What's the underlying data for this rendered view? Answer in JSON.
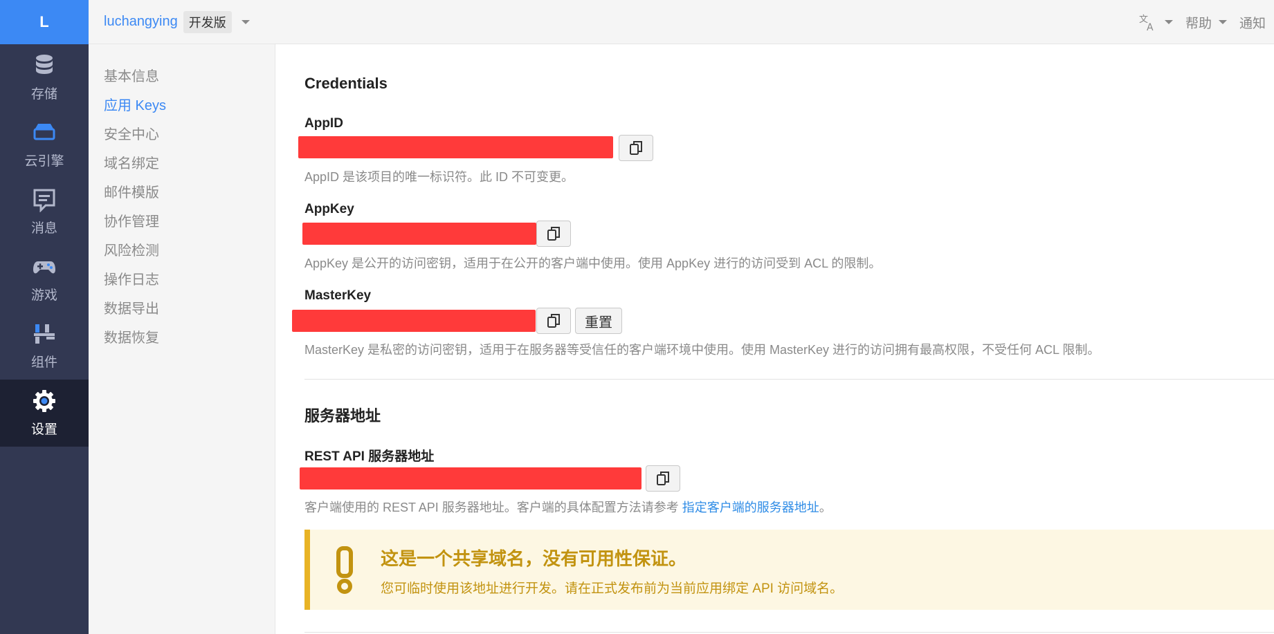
{
  "rail": {
    "logo": "L",
    "items": [
      {
        "label": "存储",
        "icon": "database-icon"
      },
      {
        "label": "云引擎",
        "icon": "server-icon"
      },
      {
        "label": "消息",
        "icon": "message-icon"
      },
      {
        "label": "游戏",
        "icon": "gamepad-icon"
      },
      {
        "label": "组件",
        "icon": "components-icon"
      },
      {
        "label": "设置",
        "icon": "gear-icon",
        "active": true
      }
    ]
  },
  "topbar": {
    "app_name": "luchangying",
    "app_badge": "开发版",
    "help": "帮助",
    "notify": "通知"
  },
  "subnav": {
    "items": [
      "基本信息",
      "应用 Keys",
      "安全中心",
      "域名绑定",
      "邮件模版",
      "协作管理",
      "风险检测",
      "操作日志",
      "数据导出",
      "数据恢复"
    ],
    "active_index": 1
  },
  "credentials": {
    "title": "Credentials",
    "appid": {
      "label": "AppID",
      "help": "AppID 是该项目的唯一标识符。此 ID 不可变更。"
    },
    "appkey": {
      "label": "AppKey",
      "help": "AppKey 是公开的访问密钥，适用于在公开的客户端中使用。使用 AppKey 进行的访问受到 ACL 的限制。"
    },
    "masterkey": {
      "label": "MasterKey",
      "reset_label": "重置",
      "help": "MasterKey 是私密的访问密钥，适用于在服务器等受信任的客户端环境中使用。使用 MasterKey 进行的访问拥有最高权限，不受任何 ACL 限制。"
    }
  },
  "server": {
    "title": "服务器地址",
    "rest_label": "REST API 服务器地址",
    "rest_help_prefix": "客户端使用的 REST API 服务器地址。客户端的具体配置方法请参考 ",
    "rest_help_link": "指定客户端的服务器地址",
    "rest_help_suffix": "。",
    "notice_title": "这是一个共享域名，没有可用性保证。",
    "notice_text": "您可临时使用该地址进行开发。请在正式发布前为当前应用绑定 API 访问域名。"
  },
  "colors": {
    "accent": "#3c89f4",
    "rail_bg": "#323852",
    "redaction": "#ff3a3a",
    "warning": "#c29310"
  }
}
